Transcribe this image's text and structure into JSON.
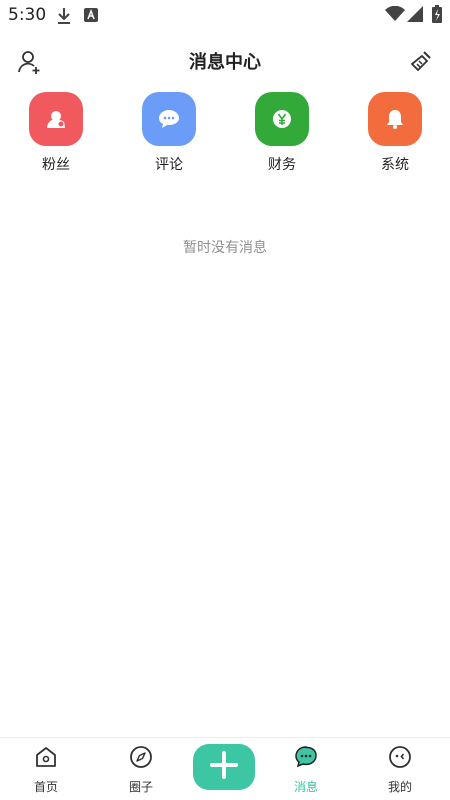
{
  "status_bar": {
    "time": "5:30",
    "icons": [
      "download-icon",
      "app-a-icon",
      "wifi-icon",
      "signal-icon",
      "battery-charging-icon"
    ]
  },
  "header": {
    "title": "消息中心",
    "left_icon": "add-user-icon",
    "right_icon": "broom-icon"
  },
  "categories": [
    {
      "label": "粉丝",
      "icon": "fan-user-icon",
      "color": "#f05a5f"
    },
    {
      "label": "评论",
      "icon": "comment-bubble-icon",
      "color": "#6b9cf7"
    },
    {
      "label": "财务",
      "icon": "yuan-coin-icon",
      "color": "#33a93a"
    },
    {
      "label": "系统",
      "icon": "bell-icon",
      "color": "#f36c3e"
    }
  ],
  "empty_state": {
    "message": "暂时没有消息"
  },
  "bottom_nav": {
    "items": [
      {
        "label": "首页",
        "icon": "home-icon"
      },
      {
        "label": "圈子",
        "icon": "compass-icon"
      },
      {
        "label": "消息",
        "icon": "chat-bubble-icon",
        "active": true
      },
      {
        "label": "我的",
        "icon": "profile-face-icon"
      }
    ],
    "compose_icon": "plus-icon",
    "accent_color": "#3cc6a4"
  }
}
